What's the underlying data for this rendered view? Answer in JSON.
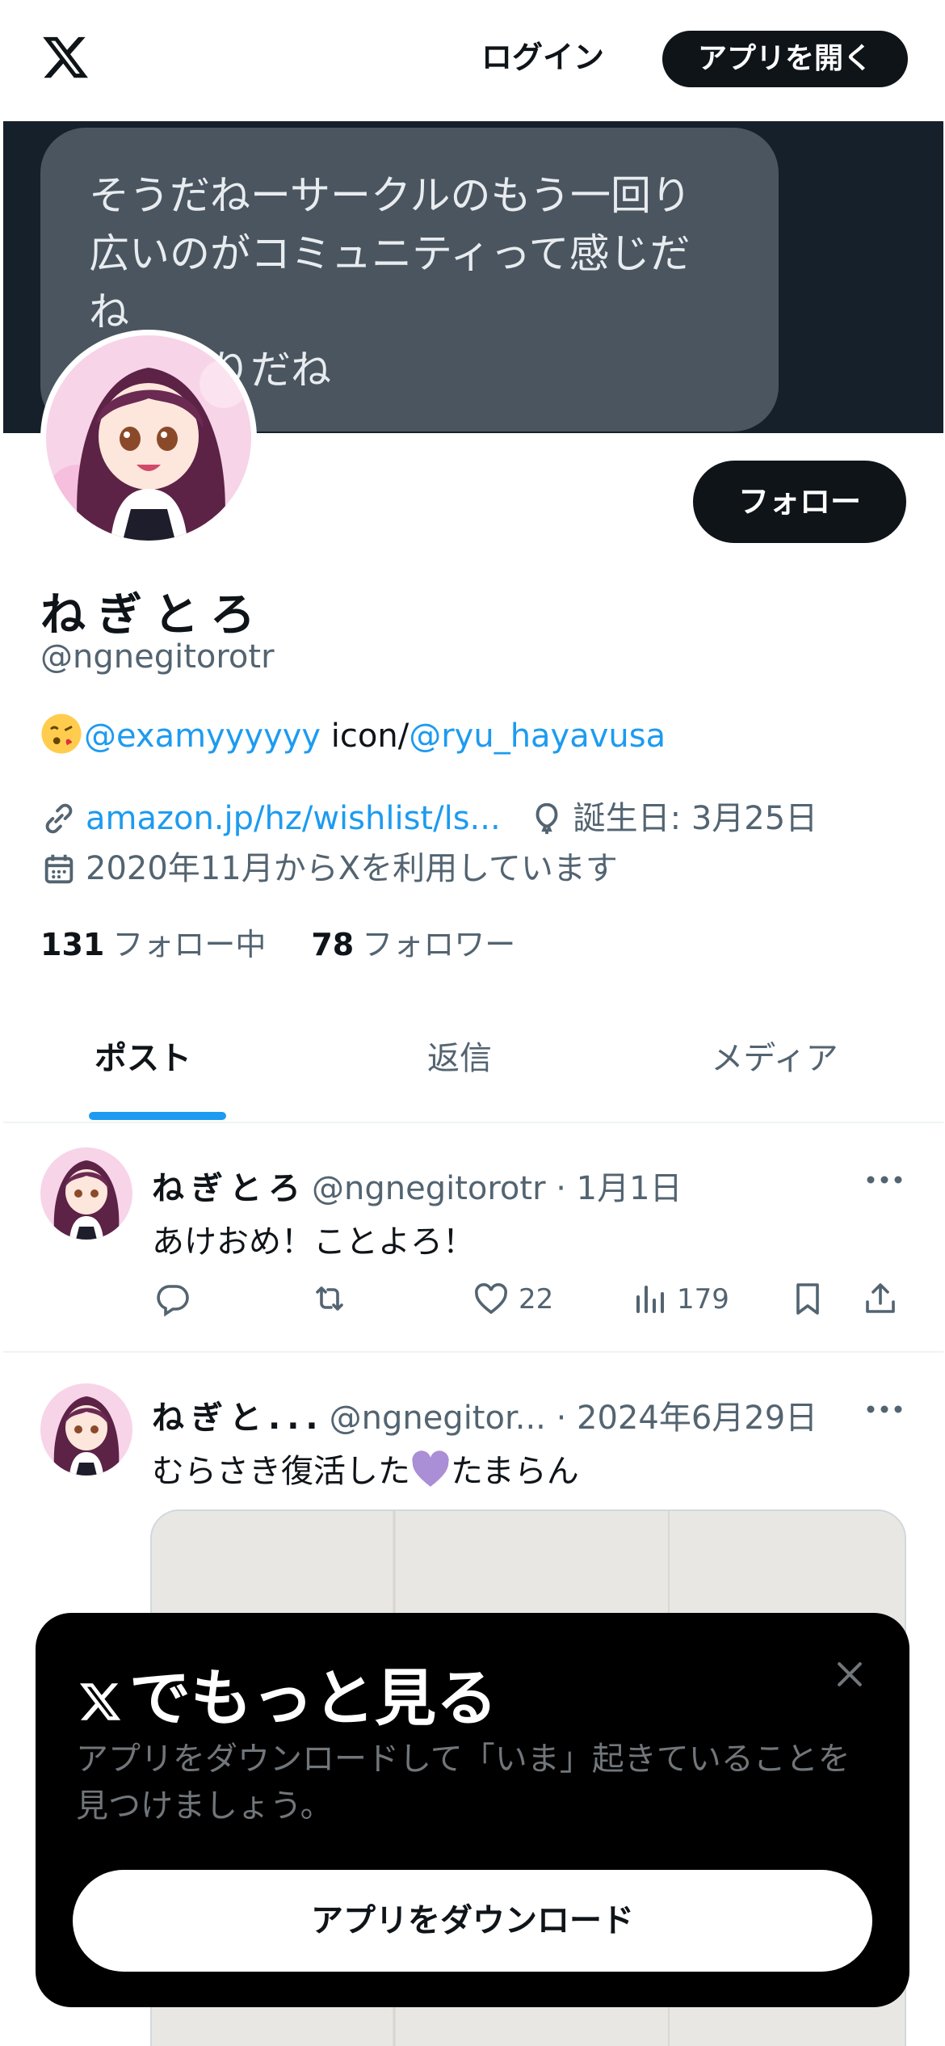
{
  "header": {
    "logo": "x-logo",
    "login_label": "ログイン",
    "open_app_label": "アプリを開く"
  },
  "banner": {
    "lines": [
      "そうだねーサークルのもう一回り",
      "広いのがコミュニティって感じだ",
      "ね",
      "その通りだね"
    ]
  },
  "profile": {
    "follow_label": "フォロー",
    "display_name": "ねぎとろ",
    "handle": "@ngnegitorotr",
    "bio": {
      "emoji": "face-blowing-kiss",
      "mention1": "@examyyyyyy",
      "text": " icon/",
      "mention2": "@ryu_hayavusa"
    },
    "website": "amazon.jp/hz/wishlist/ls...",
    "birthday": "誕生日: 3月25日",
    "joined": "2020年11月からXを利用しています",
    "following_count": "131",
    "following_label": "フォロー中",
    "followers_count": "78",
    "followers_label": "フォロワー"
  },
  "tabs": [
    {
      "label": "ポスト",
      "active": true
    },
    {
      "label": "返信",
      "active": false
    },
    {
      "label": "メディア",
      "active": false
    }
  ],
  "posts": [
    {
      "name": "ねぎとろ",
      "handle": "@ngnegitorotr",
      "date": "· 1月1日",
      "text": "あけおめ！ことよろ！",
      "likes": "22",
      "views": "179"
    },
    {
      "name": "ねぎと...",
      "handle": "@ngnegitor...",
      "date": "· 2024年6月29日",
      "text_before": "むらさき復活した",
      "text_after": "たまらん",
      "emoji": "purple-heart"
    }
  ],
  "sheet": {
    "title": "でもっと見る",
    "description": "アプリをダウンロードして「いま」起きていることを見つけましょう。",
    "download_label": "アプリをダウンロード"
  },
  "colors": {
    "accent": "#1d9bf0",
    "text": "#0f1419",
    "secondary": "#536471",
    "banner": "#16202a"
  }
}
